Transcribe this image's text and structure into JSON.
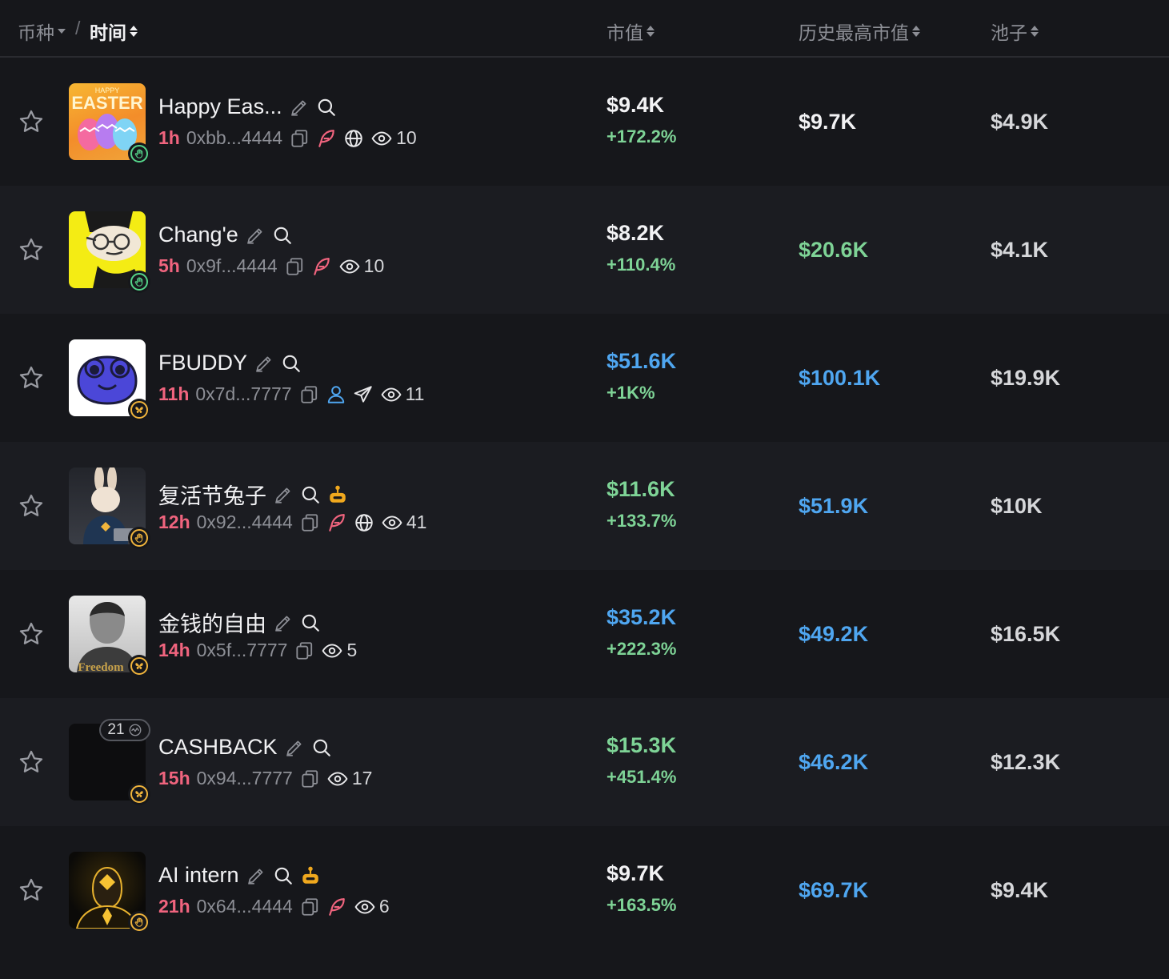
{
  "header": {
    "coin_label": "币种",
    "time_label": "时间",
    "mcap_label": "市值",
    "ath_label": "历史最高市值",
    "pool_label": "池子"
  },
  "colors": {
    "background": "#16171b",
    "row_alt": "#1b1c21",
    "positive": "#7ed396",
    "highlight_blue": "#4fa6f0",
    "age_pink": "#f0647e",
    "muted": "#8d8f96"
  },
  "rows": [
    {
      "name": "Happy Eas...",
      "age": "1h",
      "address": "0xbb...4444",
      "views": "10",
      "market_cap": "$9.4K",
      "change": "+172.2%",
      "ath": "$9.7K",
      "pool": "$4.9K",
      "icons": [
        "copy-icon",
        "feather-icon",
        "globe-icon",
        "eye-icon"
      ],
      "avatar_text_small": "HAPPY",
      "avatar_text": "EASTER"
    },
    {
      "name": "Chang'e",
      "age": "5h",
      "address": "0x9f...4444",
      "views": "10",
      "market_cap": "$8.2K",
      "change": "+110.4%",
      "ath": "$20.6K",
      "pool": "$4.1K",
      "icons": [
        "copy-icon",
        "feather-icon",
        "eye-icon"
      ]
    },
    {
      "name": "FBUDDY",
      "age": "11h",
      "address": "0x7d...7777",
      "views": "11",
      "market_cap": "$51.6K",
      "change": "+1K%",
      "ath": "$100.1K",
      "pool": "$19.9K",
      "icons": [
        "copy-icon",
        "user-icon",
        "telegram-icon",
        "eye-icon"
      ]
    },
    {
      "name": "复活节兔子",
      "age": "12h",
      "address": "0x92...4444",
      "views": "41",
      "market_cap": "$11.6K",
      "change": "+133.7%",
      "ath": "$51.9K",
      "pool": "$10K",
      "icons": [
        "copy-icon",
        "feather-icon",
        "globe-icon",
        "eye-icon"
      ]
    },
    {
      "name": "金钱的自由",
      "age": "14h",
      "address": "0x5f...7777",
      "views": "5",
      "market_cap": "$35.2K",
      "change": "+222.3%",
      "ath": "$49.2K",
      "pool": "$16.5K",
      "icons": [
        "copy-icon",
        "eye-icon"
      ],
      "avatar_text": "Freedom"
    },
    {
      "name": "CASHBACK",
      "age": "15h",
      "address": "0x94...7777",
      "views": "17",
      "market_cap": "$15.3K",
      "change": "+451.4%",
      "ath": "$46.2K",
      "pool": "$12.3K",
      "holders": "21",
      "icons": [
        "copy-icon",
        "eye-icon"
      ]
    },
    {
      "name": "AI intern",
      "age": "21h",
      "address": "0x64...4444",
      "views": "6",
      "market_cap": "$9.7K",
      "change": "+163.5%",
      "ath": "$69.7K",
      "pool": "$9.4K",
      "icons": [
        "copy-icon",
        "feather-icon",
        "eye-icon"
      ]
    }
  ]
}
